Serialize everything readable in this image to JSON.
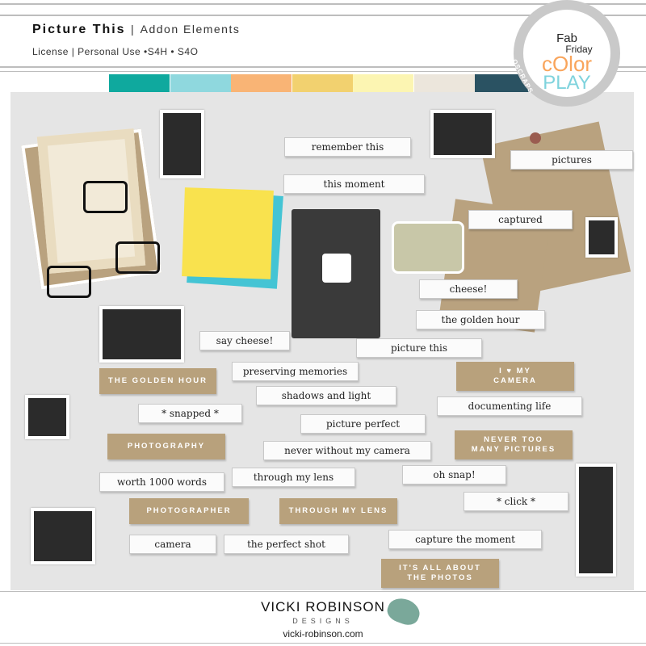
{
  "header": {
    "title": "Picture This",
    "subtitle": "Addon Elements",
    "license": "License  |  Personal Use •S4H • S4O"
  },
  "badge": {
    "line1": "Fab",
    "line2": "Friday",
    "line3": "cOlor",
    "line4": "PLAY",
    "ring_text": "OSCRAPS"
  },
  "palette": [
    "#0fa99e",
    "#8fd8de",
    "#f9b475",
    "#f2d16f",
    "#fcf5b2",
    "#ece6dc",
    "#2a5262"
  ],
  "word_strips": [
    "remember this",
    "this moment",
    "pictures",
    "captured",
    "cheese!",
    "the golden hour",
    "say cheese!",
    "picture this",
    "preserving memories",
    "shadows and light",
    "* snapped *",
    "documenting life",
    "picture perfect",
    "never without my camera",
    "worth 1000 words",
    "through my lens",
    "oh snap!",
    "* click *",
    "camera",
    "the perfect shot",
    "capture the moment"
  ],
  "kraft_labels": [
    "THE GOLDEN HOUR",
    "I ♥ MY\nCAMERA",
    "PHOTOGRAPHY",
    "NEVER TOO\nMANY PICTURES",
    "PHOTOGRAPHER",
    "THROUGH MY LENS",
    "IT'S ALL ABOUT\nTHE PHOTOS"
  ],
  "footer": {
    "brand": "VICKI ROBINSON",
    "designs": "DESIGNS",
    "url": "vicki-robinson.com"
  }
}
